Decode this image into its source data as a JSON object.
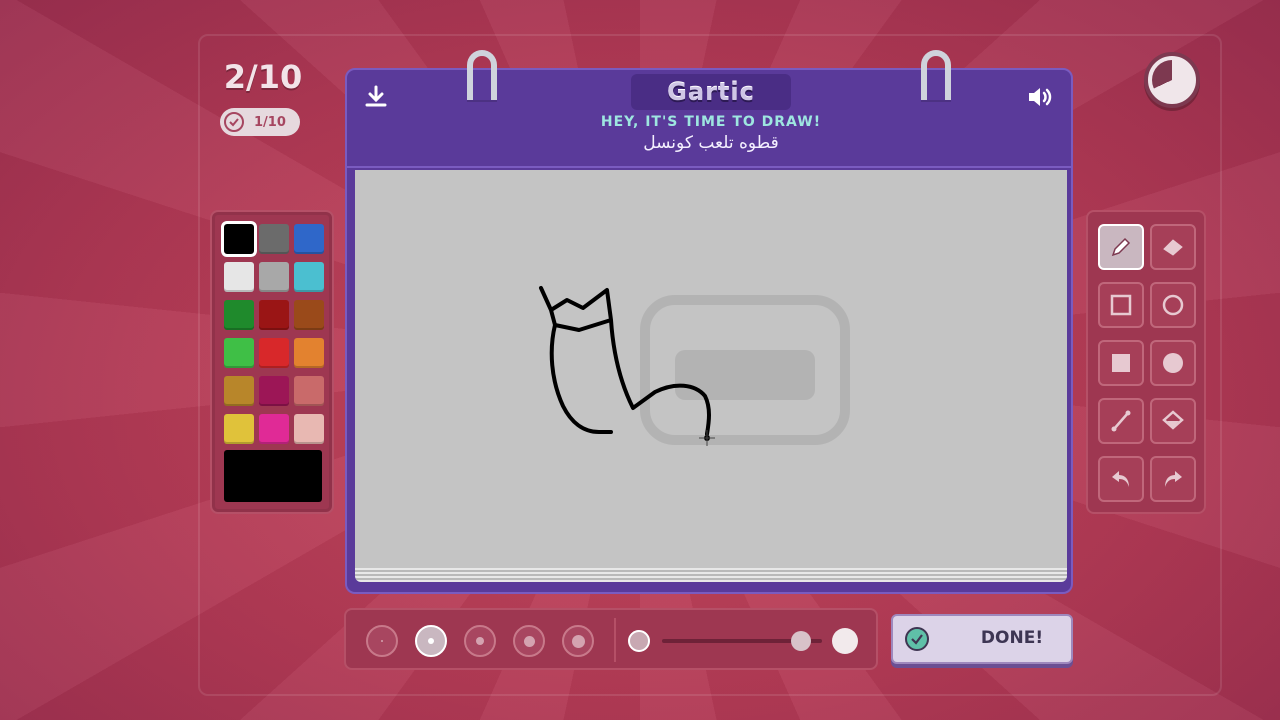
{
  "round": {
    "counter": "2/10",
    "progress": "1/10"
  },
  "timer": {
    "remaining_fraction": 0.32,
    "icon": "timer-icon"
  },
  "header": {
    "logo": "Gartic",
    "prompt_title": "HEY, IT'S TIME TO DRAW!",
    "prompt_text": "قطوه تلعب كونسل",
    "download_icon": "download-icon",
    "sound_icon": "speaker-icon"
  },
  "palette": {
    "colors": [
      "#000000",
      "#6b6b6b",
      "#2f67c9",
      "#e6e6e6",
      "#a8a8a8",
      "#4bbfd0",
      "#1f8a2c",
      "#9a1515",
      "#9a4a1a",
      "#3fbf46",
      "#d8282a",
      "#e3822f",
      "#b8862a",
      "#9c1656",
      "#c96a6a",
      "#e0c23a",
      "#e02a96",
      "#e8b8b2"
    ],
    "selected_index": 0,
    "current_color": "#000000"
  },
  "tools": [
    "pencil-icon",
    "eraser-icon",
    "square-outline-icon",
    "circle-outline-icon",
    "square-filled-icon",
    "circle-filled-icon",
    "line-icon",
    "bucket-fill-icon",
    "undo-icon",
    "redo-icon"
  ],
  "active_tool": "pencil-icon",
  "brush": {
    "sizes": 5,
    "selected_size_index": 1
  },
  "opacity": {
    "value_fraction": 0.87
  },
  "done_button": {
    "label": "DONE!"
  }
}
